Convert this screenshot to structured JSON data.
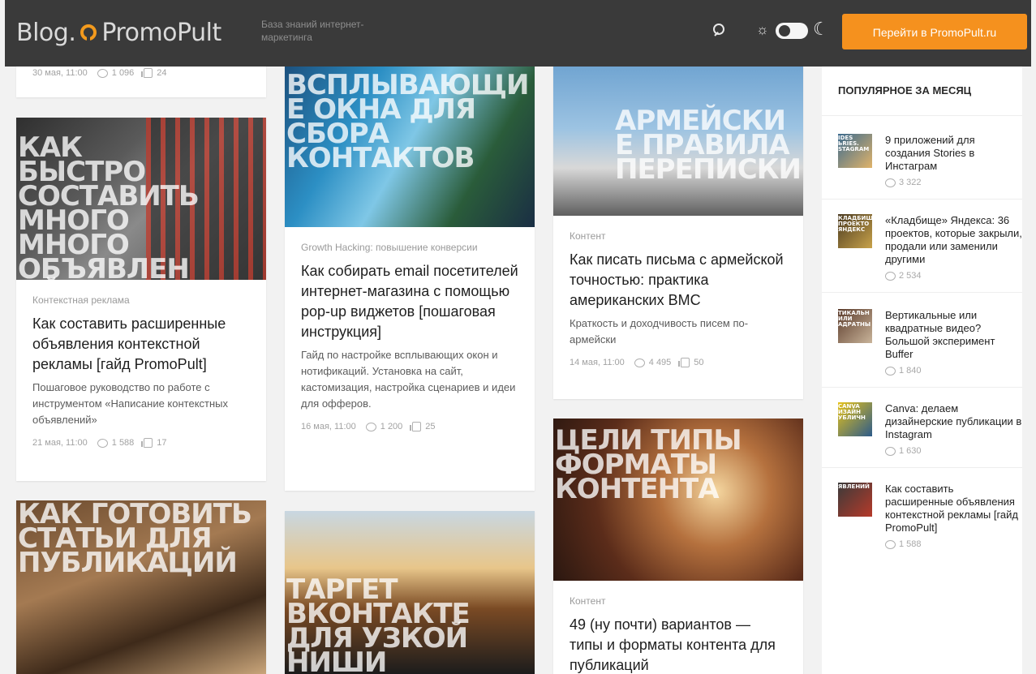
{
  "header": {
    "logo_text_1": "Blog.",
    "logo_text_2": "PromoPult",
    "tagline": "База знаний интернет-маркетинга",
    "cta_label": "Перейти в PromoPult.ru",
    "icons": {
      "search": "search-icon",
      "sun": "sun-icon",
      "moon": "moon-icon"
    },
    "accent_color": "#f5911e"
  },
  "columns": {
    "col1": {
      "top_meta": {
        "date": "30 мая, 11:00",
        "comments": "1 096",
        "likes": "24"
      },
      "card1": {
        "image_title": "Как быстро составить много много объявлений",
        "category": "Контекстная реклама",
        "title": "Как составить расширенные объявления контекстной рекламы [гайд PromoPult]",
        "excerpt": "Пошаговое руководство по работе с инструментом «Написание контекстных объявлений»",
        "date": "21 мая, 11:00",
        "comments": "1 588",
        "likes": "17"
      },
      "card2": {
        "image_title": "Как готовить статьи для публикаций"
      }
    },
    "col2": {
      "card1": {
        "image_title": "Всплывающие окна для сбора контактов",
        "category": "Growth Hacking: повышение конверсии",
        "title": "Как собирать email посетителей интернет-магазина с помощью pop-up виджетов [пошаговая инструкция]",
        "excerpt": "Гайд по настройке всплывающих окон и нотификаций. Установка на сайт, кастомизация, настройка сценариев и идеи для офферов.",
        "date": "16 мая, 11:00",
        "comments": "1 200",
        "likes": "25"
      },
      "card2": {
        "image_title": "Таргет вконтакте для узкой ниши"
      }
    },
    "col3": {
      "card1": {
        "image_title": "Армейские правила переписки",
        "category": "Контент",
        "title": "Как писать письма с армейской точностью: практика американских ВМС",
        "excerpt": "Краткость и доходчивость писем по-армейски",
        "date": "14 мая, 11:00",
        "comments": "4 495",
        "likes": "50"
      },
      "card2": {
        "image_title": "Цели типы форматы контента",
        "category": "Контент",
        "title": "49 (ну почти) вариантов — типы и форматы контента для публикаций"
      }
    }
  },
  "sidebar": {
    "heading": "ПОПУЛЯРНОЕ ЗА МЕСЯЦ",
    "items": [
      {
        "title": "9 приложений для создания Stories в Инстаграм",
        "comments": "3 322",
        "thumb_label": "ides ьries. stagram"
      },
      {
        "title": "«Кладбище» Яндекса: 36 проектов, которые закрыли, продали или заменили другими",
        "comments": "2 534",
        "thumb_label": "кладбищ проекто яндекс"
      },
      {
        "title": "Вертикальные или квадратные видео? Большой эксперимент Buffer",
        "comments": "1 840",
        "thumb_label": "тикальн или адратны"
      },
      {
        "title": "Canva: делаем дизайнерские публикации в Instagram",
        "comments": "1 630",
        "thumb_label": "canva изайн убличн"
      },
      {
        "title": "Как составить расширенные объявления контекстной рекламы [гайд PromoPult]",
        "comments": "1 588",
        "thumb_label": "явлений"
      }
    ]
  }
}
